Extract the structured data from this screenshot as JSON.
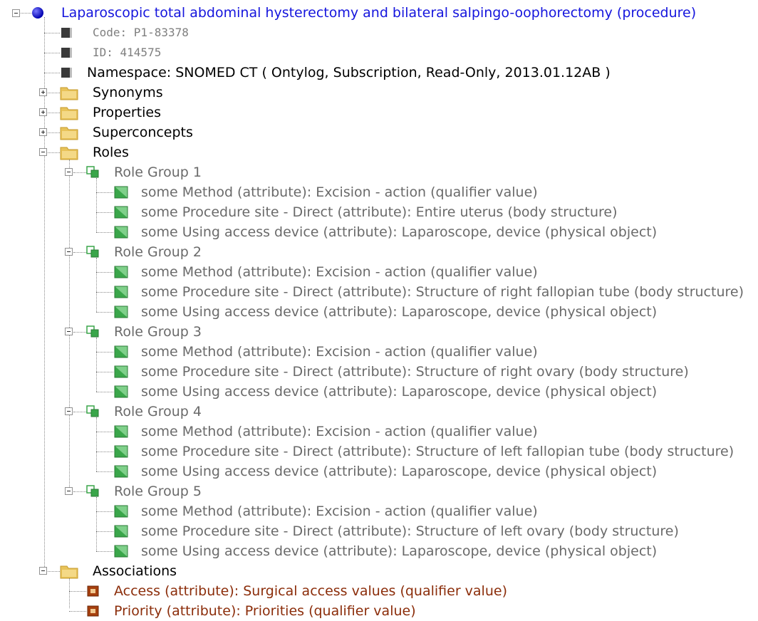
{
  "root": {
    "label": "Laparoscopic total abdominal hysterectomy and bilateral salpingo-oophorectomy (procedure)",
    "icon": "blue-circle-icon"
  },
  "details": {
    "code": "Code: P1-83378",
    "id": "ID: 414575",
    "namespace": "Namespace: SNOMED CT ( Ontylog, Subscription, Read-Only, 2013.01.12AB )"
  },
  "folders": {
    "synonyms": "Synonyms",
    "properties": "Properties",
    "superconcepts": "Superconcepts",
    "roles": "Roles",
    "associations": "Associations"
  },
  "role_groups": [
    {
      "label": "Role Group 1",
      "items": [
        "some Method (attribute):  Excision - action (qualifier value)",
        "some Procedure site - Direct (attribute):  Entire uterus (body structure)",
        "some Using access device (attribute):  Laparoscope, device (physical object)"
      ]
    },
    {
      "label": "Role Group 2",
      "items": [
        "some Method (attribute):  Excision - action (qualifier value)",
        "some Procedure site - Direct (attribute):  Structure of right fallopian tube (body structure)",
        "some Using access device (attribute):  Laparoscope, device (physical object)"
      ]
    },
    {
      "label": "Role Group 3",
      "items": [
        "some Method (attribute):  Excision - action (qualifier value)",
        "some Procedure site - Direct (attribute):  Structure of right ovary (body structure)",
        "some Using access device (attribute):  Laparoscope, device (physical object)"
      ]
    },
    {
      "label": "Role Group 4",
      "items": [
        "some Method (attribute):  Excision - action (qualifier value)",
        "some Procedure site - Direct (attribute):  Structure of left fallopian tube (body structure)",
        "some Using access device (attribute):  Laparoscope, device (physical object)"
      ]
    },
    {
      "label": "Role Group 5",
      "items": [
        "some Method (attribute):  Excision - action (qualifier value)",
        "some Procedure site - Direct (attribute):  Structure of left ovary (body structure)",
        "some Using access device (attribute):  Laparoscope, device (physical object)"
      ]
    }
  ],
  "associations": [
    "Access (attribute): Surgical access values (qualifier value)",
    "Priority (attribute): Priorities (qualifier value)"
  ],
  "colors": {
    "root_text": "#1515dd",
    "muted_text": "#7f7f7f",
    "association_text": "#8b2d0a",
    "folder": "#e8c35a",
    "role_icon": "#3aa64a"
  }
}
